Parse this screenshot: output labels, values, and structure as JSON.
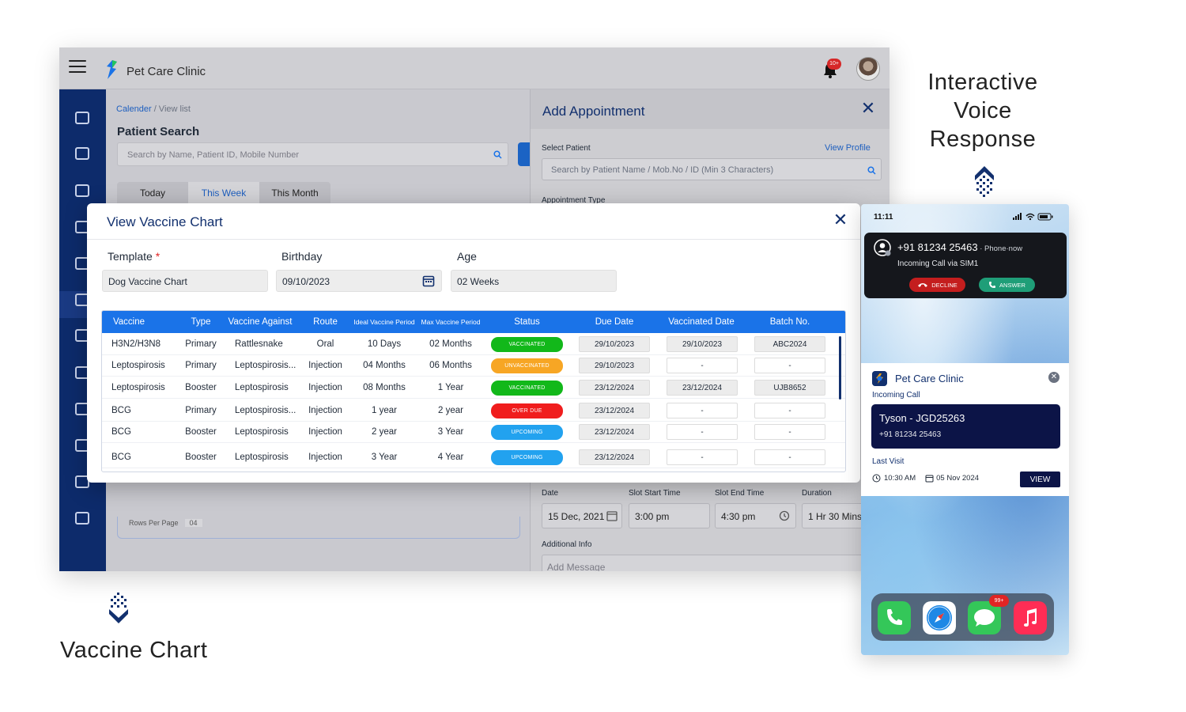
{
  "app": {
    "title": "Pet Care Clinic",
    "notification_badge": "10+",
    "brand_color": "#0d2b6b",
    "accent_color": "#1a73e8"
  },
  "content": {
    "breadcrumb_link": "Calender",
    "breadcrumb_rest": " / View list",
    "page_title": "Patient Search",
    "search_placeholder": "Search by Name, Patient ID, Mobile Number",
    "tabs": [
      "Today",
      "This Week",
      "This Month"
    ],
    "active_tab": "This Week",
    "rows_per_page_label": "Rows Per Page",
    "rows_per_page_value": "04"
  },
  "appointment": {
    "title": "Add Appointment",
    "select_patient_label": "Select Patient",
    "view_profile": "View Profile",
    "search_placeholder": "Search by Patient Name / Mob.No / ID (Min 3 Characters)",
    "appointment_type_label": "Appointment Type",
    "date_label": "Date",
    "slot_start_label": "Slot Start Time",
    "slot_end_label": "Slot End Time",
    "duration_label": "Duration",
    "date_value": "15 Dec, 2021",
    "slot_start_value": "3:00 pm",
    "slot_end_value": "4:30 pm",
    "duration_value": "1 Hr 30 Mins",
    "additional_info_label": "Additional Info",
    "message_placeholder": "Add Message"
  },
  "vaccine_modal": {
    "title": "View Vaccine Chart",
    "template_label": "Template",
    "template_required": "*",
    "template_value": "Dog Vaccine Chart",
    "birthday_label": "Birthday",
    "birthday_value": "09/10/2023",
    "age_label": "Age",
    "age_value": "02 Weeks",
    "columns": [
      "Vaccine",
      "Type",
      "Vaccine Against",
      "Route",
      "Ideal Vaccine Period",
      "Max Vaccine Period",
      "Status",
      "Due Date",
      "Vaccinated Date",
      "Batch No."
    ],
    "rows": [
      {
        "vaccine": "H3N2/H3N8",
        "type": "Primary",
        "against": "Rattlesnake",
        "route": "Oral",
        "ideal": "10 Days",
        "max": "02 Months",
        "status": "VACCINATED",
        "due": "29/10/2023",
        "vaccinated": "29/10/2023",
        "batch": "ABC2024"
      },
      {
        "vaccine": "Leptospirosis",
        "type": "Primary",
        "against": "Leptospirosis...",
        "route": "Injection",
        "ideal": "04 Months",
        "max": "06 Months",
        "status": "UNVACCINATED",
        "due": "29/10/2023",
        "vaccinated": "-",
        "batch": "-"
      },
      {
        "vaccine": "Leptospirosis",
        "type": "Booster",
        "against": "Leptospirosis",
        "route": "Injection",
        "ideal": "08 Months",
        "max": "1 Year",
        "status": "VACCINATED",
        "due": "23/12/2024",
        "vaccinated": "23/12/2024",
        "batch": "UJB8652"
      },
      {
        "vaccine": "BCG",
        "type": "Primary",
        "against": "Leptospirosis...",
        "route": "Injection",
        "ideal": "1 year",
        "max": "2 year",
        "status": "OVER DUE",
        "due": "23/12/2024",
        "vaccinated": "-",
        "batch": "-"
      },
      {
        "vaccine": "BCG",
        "type": "Booster",
        "against": "Leptospirosis",
        "route": "Injection",
        "ideal": "2 year",
        "max": "3 Year",
        "status": "UPCOMING",
        "due": "23/12/2024",
        "vaccinated": "-",
        "batch": "-"
      },
      {
        "vaccine": "BCG",
        "type": "Booster",
        "against": "Leptospirosis",
        "route": "Injection",
        "ideal": "3 Year",
        "max": "4 Year",
        "status": "UPCOMING",
        "due": "23/12/2024",
        "vaccinated": "-",
        "batch": "-"
      }
    ],
    "status_colors": {
      "VACCINATED": "#12b81a",
      "UNVACCINATED": "#f7a624",
      "OVER DUE": "#f01d1d",
      "UPCOMING": "#22a2ef"
    }
  },
  "headings": {
    "ivr_line1": "Interactive",
    "ivr_line2": "Voice",
    "ivr_line3": "Response",
    "vaccine_chart": "Vaccine Chart"
  },
  "phone": {
    "time": "11:11",
    "call_number": "+91 81234 25463",
    "call_meta": " · Phone·now",
    "call_sub": "Incoming Call via SIM1",
    "decline": "DECLINE",
    "answer": "ANSWER",
    "notif_title": "Pet Care Clinic",
    "notif_sub": "Incoming Call",
    "caller_name": "Tyson - JGD25263",
    "caller_phone": "+91 81234 25463",
    "last_visit_label": "Last Visit",
    "last_visit_time": "10:30 AM",
    "last_visit_date": "05 Nov 2024",
    "view": "VIEW",
    "messages_badge": "99+"
  }
}
